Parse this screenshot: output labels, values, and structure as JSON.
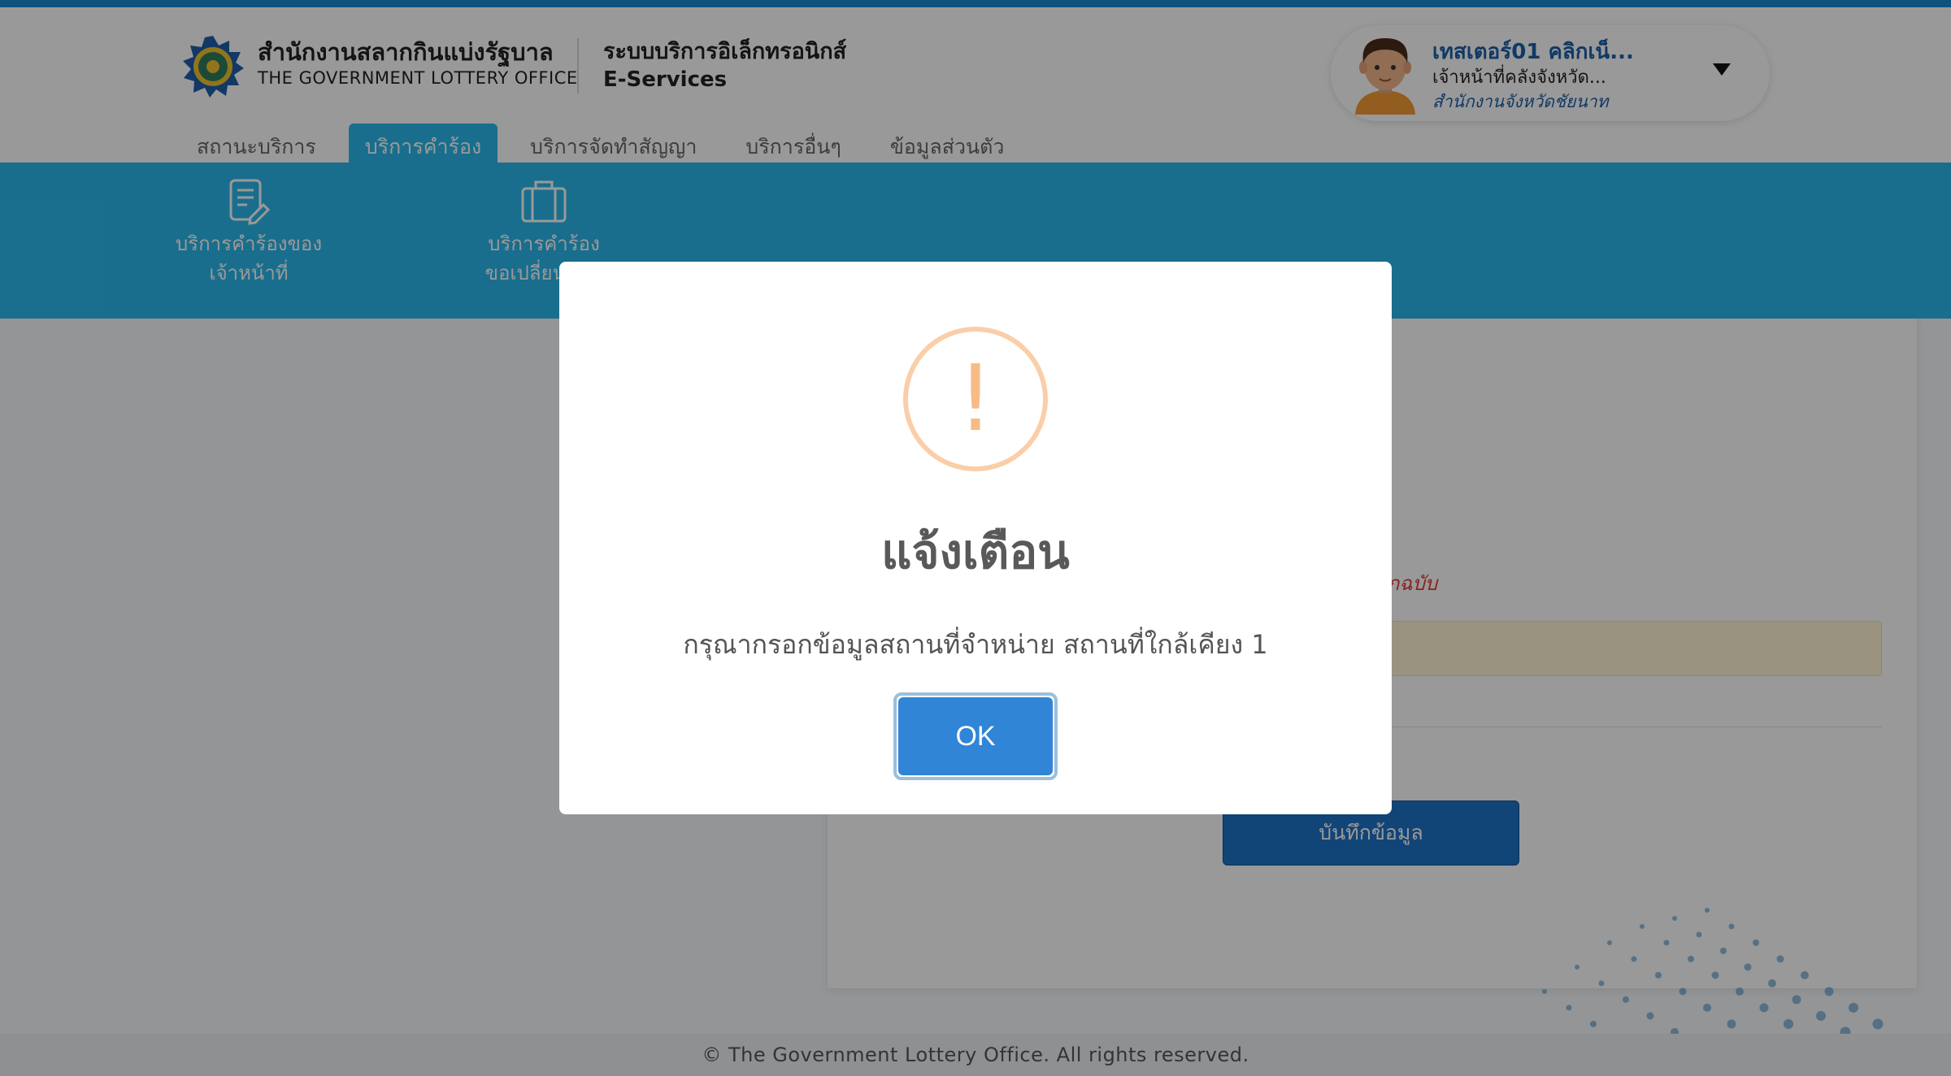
{
  "header": {
    "org_name_th": "สำนักงานสลากกินแบ่งรัฐบาล",
    "org_name_en": "THE GOVERNMENT LOTTERY OFFICE",
    "system_name_th": "ระบบบริการอิเล็กทรอนิกส์",
    "system_name_en": "E-Services"
  },
  "user": {
    "name": "เทสเตอร์01 คลิกเน็...",
    "role": "เจ้าหน้าที่คลังจังหวัด...",
    "office": "สำนักงานจังหวัดชัยนาท"
  },
  "nav": {
    "tabs": [
      {
        "label": "สถานะบริการ",
        "active": false
      },
      {
        "label": "บริการคำร้อง",
        "active": true
      },
      {
        "label": "บริการจัดทำสัญญา",
        "active": false
      },
      {
        "label": "บริการอื่นๆ",
        "active": false
      },
      {
        "label": "ข้อมูลส่วนตัว",
        "active": false
      }
    ]
  },
  "subnav": {
    "items": [
      {
        "line1": "บริการคำร้องของ",
        "line2": "เจ้าหน้าที่",
        "icon": "document-edit-icon"
      },
      {
        "line1": "บริการคำร้อง",
        "line2": "ขอเปลี่ยนแปล",
        "icon": "briefcase-icon"
      }
    ]
  },
  "form": {
    "note_red": "ะทุกฉบับ",
    "save_label": "บันทึกข้อมูล"
  },
  "footer": {
    "copyright": "© The Government Lottery Office. All rights reserved."
  },
  "modal": {
    "icon": "warning-icon",
    "icon_symbol": "!",
    "title": "แจ้งเตือน",
    "message": "กรุณากรอกข้อมูลสถานที่จำหน่าย สถานที่ใกล้เคียง 1",
    "ok_label": "OK"
  },
  "colors": {
    "primary": "#2bb7ec",
    "top_line": "#1a8ad0",
    "ok_button": "#3085d6",
    "warning_icon": "#f8bb86",
    "save_button": "#1e73c7"
  }
}
